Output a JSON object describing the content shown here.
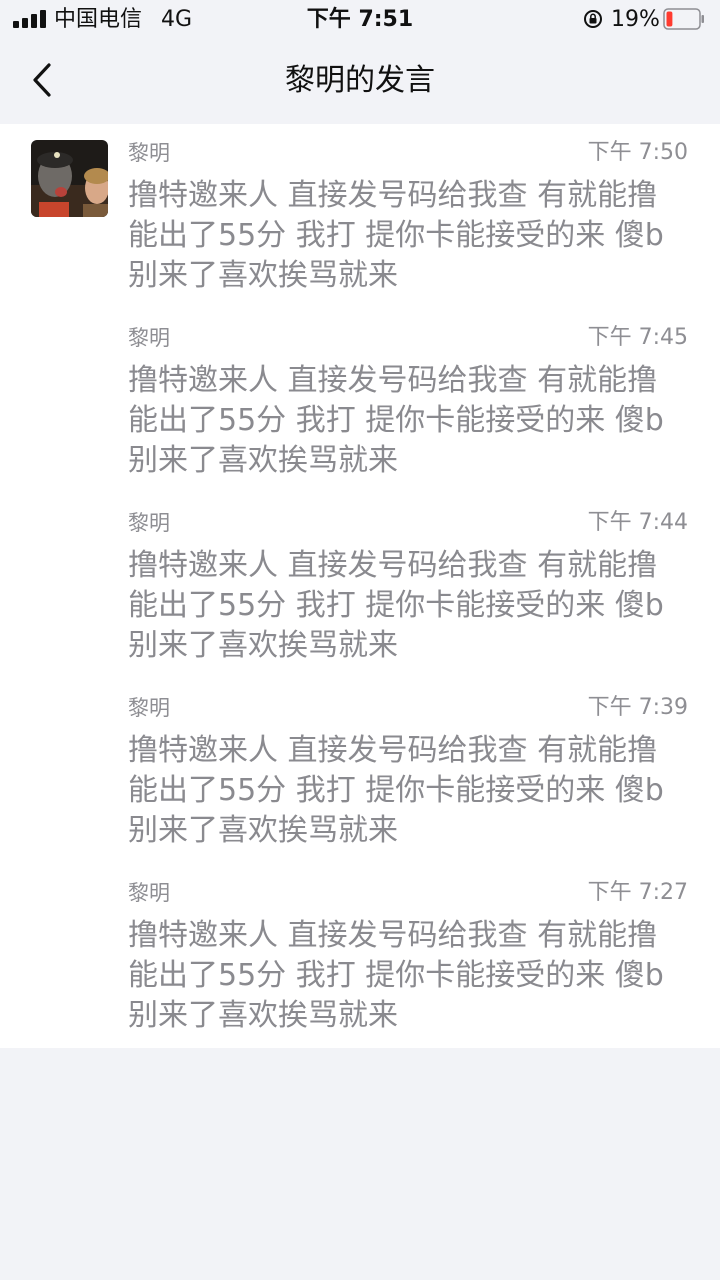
{
  "status_bar": {
    "carrier": "中国电信",
    "network": "4G",
    "time": "下午 7:51",
    "battery_percent": "19%",
    "battery_level": 0.19,
    "battery_color": "#ff3b30"
  },
  "nav": {
    "title": "黎明的发言",
    "back_icon": "chevron-left-icon"
  },
  "messages": [
    {
      "sender": "黎明",
      "time": "下午 7:50",
      "text": "撸特邀来人 直接发号码给我查 有就能撸 能出了55分 我打 提你卡能接受的来  傻b别来了喜欢挨骂就来"
    },
    {
      "sender": "黎明",
      "time": "下午 7:45",
      "text": "撸特邀来人 直接发号码给我查 有就能撸 能出了55分 我打 提你卡能接受的来  傻b别来了喜欢挨骂就来"
    },
    {
      "sender": "黎明",
      "time": "下午 7:44",
      "text": "撸特邀来人 直接发号码给我查 有就能撸 能出了55分 我打 提你卡能接受的来  傻b别来了喜欢挨骂就来"
    },
    {
      "sender": "黎明",
      "time": "下午 7:39",
      "text": "撸特邀来人 直接发号码给我查 有就能撸 能出了55分 我打 提你卡能接受的来  傻b别来了喜欢挨骂就来"
    },
    {
      "sender": "黎明",
      "time": "下午 7:27",
      "text": "撸特邀来人 直接发号码给我查 有就能撸 能出了55分 我打 提你卡能接受的来  傻b别来了喜欢挨骂就来"
    }
  ]
}
